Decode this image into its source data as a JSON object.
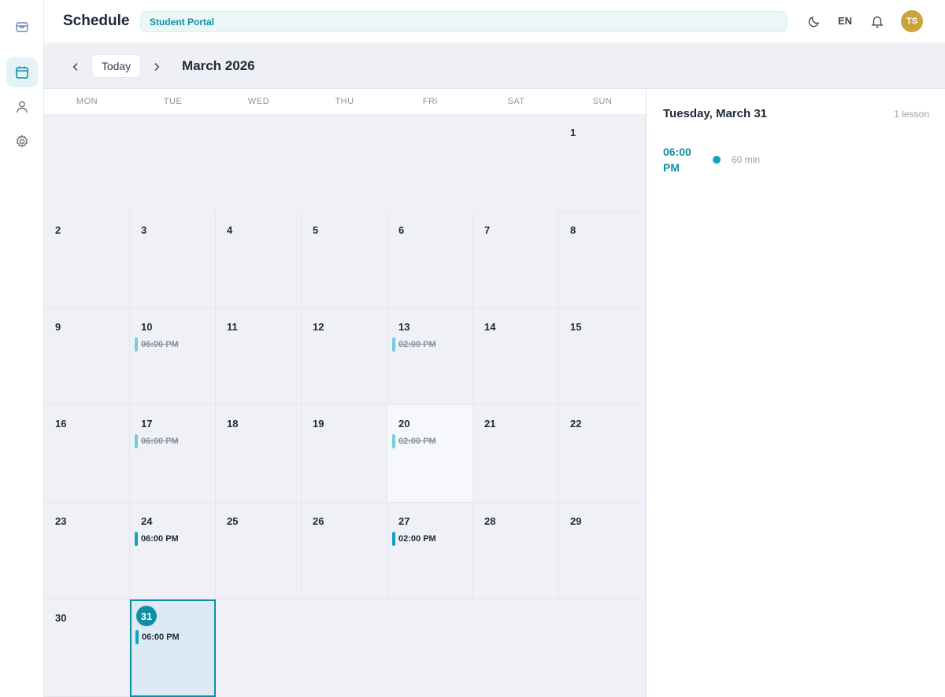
{
  "sidebar": {
    "items": [
      {
        "name": "home",
        "icon": "inbox-box-icon"
      },
      {
        "name": "schedule",
        "icon": "calendar-icon",
        "active": true
      },
      {
        "name": "profile",
        "icon": "user-icon"
      },
      {
        "name": "settings",
        "icon": "gear-icon"
      }
    ]
  },
  "header": {
    "title": "Schedule",
    "portal_label": "Student Portal",
    "language": "EN",
    "avatar_initials": "TS"
  },
  "toolbar": {
    "today_label": "Today",
    "month_title": "March 2026"
  },
  "calendar": {
    "weekdays": [
      "MON",
      "TUE",
      "WED",
      "THU",
      "FRI",
      "SAT",
      "SUN"
    ],
    "weeks": [
      [
        null,
        null,
        null,
        null,
        null,
        null,
        {
          "day": "1"
        }
      ],
      [
        {
          "day": "2"
        },
        {
          "day": "3"
        },
        {
          "day": "4"
        },
        {
          "day": "5"
        },
        {
          "day": "6"
        },
        {
          "day": "7"
        },
        {
          "day": "8"
        }
      ],
      [
        {
          "day": "9"
        },
        {
          "day": "10",
          "event": "06:00 PM",
          "past": true
        },
        {
          "day": "11"
        },
        {
          "day": "12"
        },
        {
          "day": "13",
          "event": "02:00 PM",
          "past": true
        },
        {
          "day": "14"
        },
        {
          "day": "15"
        }
      ],
      [
        {
          "day": "16"
        },
        {
          "day": "17",
          "event": "06:00 PM",
          "past": true
        },
        {
          "day": "18"
        },
        {
          "day": "19"
        },
        {
          "day": "20",
          "event": "02:00 PM",
          "past": true,
          "light": true
        },
        {
          "day": "21"
        },
        {
          "day": "22"
        }
      ],
      [
        {
          "day": "23"
        },
        {
          "day": "24",
          "event": "06:00 PM"
        },
        {
          "day": "25"
        },
        {
          "day": "26"
        },
        {
          "day": "27",
          "event": "02:00 PM"
        },
        {
          "day": "28"
        },
        {
          "day": "29"
        }
      ],
      [
        {
          "day": "30"
        },
        {
          "day": "31",
          "event": "06:00 PM",
          "selected": true
        },
        null,
        null,
        null,
        null,
        null
      ]
    ]
  },
  "detail": {
    "date_title": "Tuesday, March 31",
    "lesson_count": "1 lesson",
    "lessons": [
      {
        "time": "06:00 PM",
        "duration": "60 min"
      }
    ]
  },
  "colors": {
    "accent": "#0e8fa7",
    "event_bar": "#11a3bf",
    "avatar": "#c9a33b"
  }
}
